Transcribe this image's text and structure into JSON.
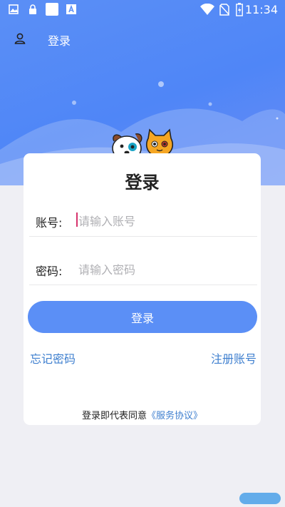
{
  "status_bar": {
    "time": "11:34",
    "icons": [
      "image-icon",
      "lock-icon",
      "app-icon",
      "font-icon",
      "wifi-icon",
      "no-sim-icon",
      "battery-icon"
    ]
  },
  "nav": {
    "title": "登录",
    "user_icon": "user-icon"
  },
  "card": {
    "title": "登录",
    "account_label": "账号:",
    "account_placeholder": "请输入账号",
    "password_label": "密码:",
    "password_placeholder": "请输入密码",
    "login_button": "登录",
    "forgot_link": "忘记密码",
    "register_link": "注册账号",
    "agreement_prefix": "登录即代表同意",
    "agreement_link": "《服务协议》"
  },
  "colors": {
    "hero": "#5b8ff6",
    "button": "#5b8ff6",
    "link": "#3e7fcf",
    "background": "#efeff4"
  }
}
